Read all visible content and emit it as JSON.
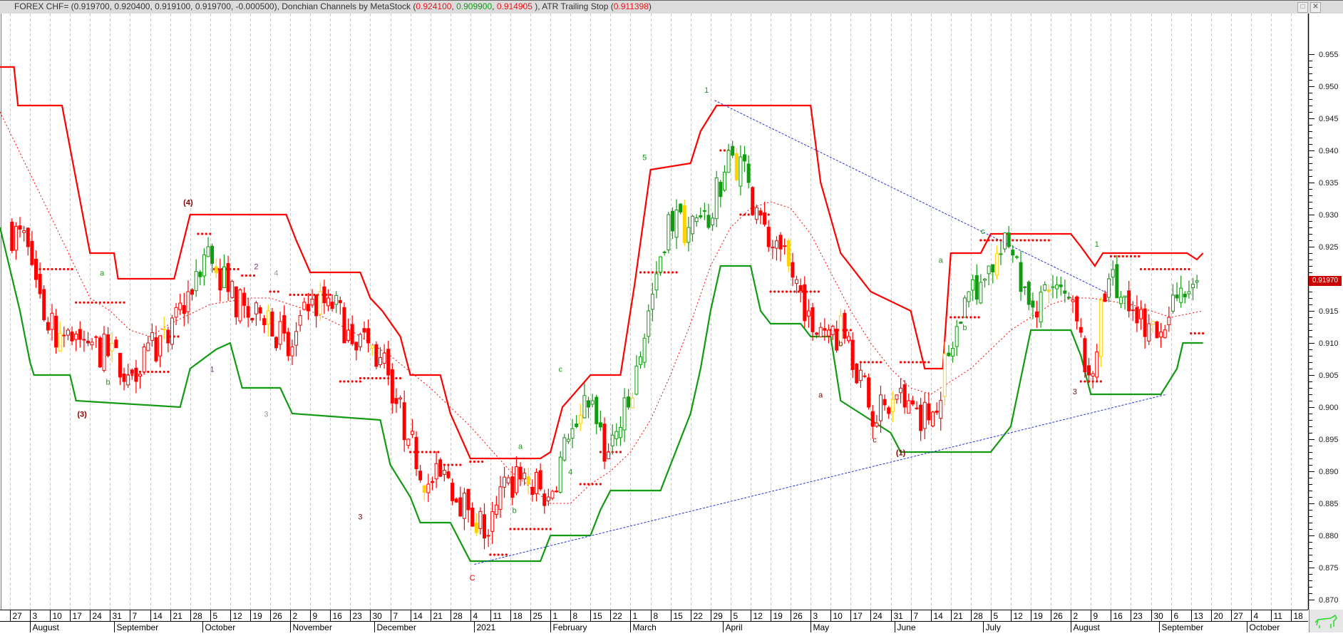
{
  "window": {
    "title_prefix": "FOREX CHF= (0.919700, 0.920400, 0.919100, 0.919700, -0.000500), Donchian Channels by MetaStock (",
    "donchian_upper": "0.924100",
    "donchian_lower": "0.909900",
    "donchian_mid": "0.914905",
    "atr_prefix": " ), ATR Trailing Stop (",
    "atr_value": "0.911398",
    "title_suffix": ")",
    "maximize_icon": "maximize-icon",
    "close_icon": "close-icon",
    "logo_icon": "bull-icon"
  },
  "colors": {
    "up": "#139a13",
    "down": "#ff0000",
    "neutral": "#ffd200",
    "upper": "#ff0000",
    "lower": "#139a13",
    "trend": "#2233dd"
  },
  "chart_data": {
    "type": "candlestick",
    "title": "FOREX CHF=",
    "x_unit": "weeks since 2020-07-27",
    "ylim": [
      0.868,
      0.96
    ],
    "y_ticks": [
      "0.870",
      "0.875",
      "0.880",
      "0.885",
      "0.890",
      "0.895",
      "0.900",
      "0.905",
      "0.910",
      "0.915",
      "0.920",
      "0.925",
      "0.930",
      "0.935",
      "0.940",
      "0.945",
      "0.950",
      "0.955"
    ],
    "last_price_label": "0.91970",
    "last_price": 0.9197,
    "week_labels": [
      "27",
      "3",
      "10",
      "17",
      "24",
      "31",
      "7",
      "14",
      "21",
      "28",
      "5",
      "12",
      "19",
      "26",
      "2",
      "9",
      "16",
      "23",
      "30",
      "7",
      "14",
      "21",
      "28",
      "4",
      "11",
      "18",
      "25",
      "1",
      "8",
      "15",
      "22",
      "1",
      "8",
      "15",
      "22",
      "29",
      "5",
      "12",
      "19",
      "26",
      "3",
      "10",
      "17",
      "24",
      "31",
      "7",
      "14",
      "21",
      "28",
      "5",
      "12",
      "19",
      "26",
      "2",
      "9",
      "16",
      "23",
      "30",
      "6",
      "13",
      "20",
      "27",
      "4",
      "11",
      "18"
    ],
    "month_labels": [
      {
        "label": "August",
        "week": 1.0
      },
      {
        "label": "September",
        "week": 5.2
      },
      {
        "label": "October",
        "week": 9.6
      },
      {
        "label": "November",
        "week": 14.0
      },
      {
        "label": "December",
        "week": 18.2
      },
      {
        "label": "2021",
        "week": 23.2
      },
      {
        "label": "February",
        "week": 27.0
      },
      {
        "label": "March",
        "week": 31.0
      },
      {
        "label": "April",
        "week": 35.6
      },
      {
        "label": "May",
        "week": 40.0
      },
      {
        "label": "June",
        "week": 44.2
      },
      {
        "label": "July",
        "week": 48.6
      },
      {
        "label": "August",
        "week": 53.0
      },
      {
        "label": "September",
        "week": 57.4
      },
      {
        "label": "October",
        "week": 61.8
      }
    ],
    "weekly_close": [
      0.928,
      0.925,
      0.912,
      0.912,
      0.91,
      0.908,
      0.905,
      0.91,
      0.91,
      0.918,
      0.925,
      0.918,
      0.914,
      0.915,
      0.908,
      0.915,
      0.917,
      0.912,
      0.91,
      0.905,
      0.895,
      0.888,
      0.889,
      0.884,
      0.88,
      0.889,
      0.888,
      0.886,
      0.895,
      0.9,
      0.893,
      0.9,
      0.915,
      0.93,
      0.928,
      0.928,
      0.94,
      0.935,
      0.925,
      0.922,
      0.915,
      0.912,
      0.911,
      0.9,
      0.899,
      0.901,
      0.898,
      0.908,
      0.918,
      0.922,
      0.925,
      0.916,
      0.918,
      0.917,
      0.905,
      0.92,
      0.915,
      0.913,
      0.914,
      0.918,
      0.9197
    ],
    "weekly_close_start_week": -1,
    "donchian_upper": [
      [
        -0.6,
        0.953
      ],
      [
        0.2,
        0.953
      ],
      [
        0.4,
        0.947
      ],
      [
        2.6,
        0.947
      ],
      [
        4,
        0.924
      ],
      [
        5.2,
        0.924
      ],
      [
        5.4,
        0.92
      ],
      [
        8.2,
        0.92
      ],
      [
        9,
        0.93
      ],
      [
        13.8,
        0.93
      ],
      [
        14.3,
        0.926
      ],
      [
        15,
        0.921
      ],
      [
        17.5,
        0.921
      ],
      [
        18,
        0.917
      ],
      [
        18.6,
        0.915
      ],
      [
        19.5,
        0.911
      ],
      [
        20,
        0.905
      ],
      [
        21.5,
        0.905
      ],
      [
        22,
        0.899
      ],
      [
        23,
        0.892
      ],
      [
        26.5,
        0.892
      ],
      [
        27,
        0.893
      ],
      [
        27.6,
        0.9
      ],
      [
        29,
        0.905
      ],
      [
        30.5,
        0.905
      ],
      [
        31.2,
        0.919
      ],
      [
        32,
        0.937
      ],
      [
        34,
        0.938
      ],
      [
        34.5,
        0.943
      ],
      [
        35.3,
        0.947
      ],
      [
        40,
        0.947
      ],
      [
        40.5,
        0.935
      ],
      [
        41.5,
        0.924
      ],
      [
        43,
        0.918
      ],
      [
        45,
        0.915
      ],
      [
        45.7,
        0.906
      ],
      [
        46.6,
        0.906
      ],
      [
        47,
        0.924
      ],
      [
        48.5,
        0.924
      ],
      [
        49,
        0.927
      ],
      [
        53,
        0.927
      ],
      [
        53.5,
        0.925
      ],
      [
        54.2,
        0.922
      ],
      [
        54.6,
        0.924
      ],
      [
        58.8,
        0.924
      ],
      [
        59.3,
        0.923
      ],
      [
        59.6,
        0.924
      ]
    ],
    "donchian_lower": [
      [
        -0.5,
        0.928
      ],
      [
        0.5,
        0.915
      ],
      [
        1,
        0.907
      ],
      [
        1.2,
        0.905
      ],
      [
        3,
        0.905
      ],
      [
        3.3,
        0.901
      ],
      [
        8.5,
        0.9
      ],
      [
        9,
        0.906
      ],
      [
        10.3,
        0.909
      ],
      [
        11,
        0.91
      ],
      [
        11.6,
        0.903
      ],
      [
        13.5,
        0.903
      ],
      [
        14.1,
        0.899
      ],
      [
        18.5,
        0.898
      ],
      [
        19,
        0.891
      ],
      [
        20,
        0.886
      ],
      [
        20.5,
        0.882
      ],
      [
        22,
        0.882
      ],
      [
        23,
        0.876
      ],
      [
        26.5,
        0.876
      ],
      [
        27,
        0.88
      ],
      [
        29,
        0.88
      ],
      [
        29.5,
        0.884
      ],
      [
        30,
        0.887
      ],
      [
        32.5,
        0.887
      ],
      [
        33,
        0.891
      ],
      [
        34,
        0.899
      ],
      [
        34.5,
        0.906
      ],
      [
        35,
        0.915
      ],
      [
        35.5,
        0.922
      ],
      [
        37,
        0.922
      ],
      [
        37.5,
        0.915
      ],
      [
        38,
        0.913
      ],
      [
        39.5,
        0.913
      ],
      [
        40,
        0.911
      ],
      [
        41,
        0.911
      ],
      [
        41.5,
        0.901
      ],
      [
        42.5,
        0.899
      ],
      [
        44,
        0.896
      ],
      [
        44.5,
        0.893
      ],
      [
        49,
        0.893
      ],
      [
        50,
        0.897
      ],
      [
        51,
        0.912
      ],
      [
        53,
        0.912
      ],
      [
        53.5,
        0.908
      ],
      [
        54,
        0.902
      ],
      [
        57.5,
        0.902
      ],
      [
        58.3,
        0.906
      ],
      [
        58.6,
        0.91
      ],
      [
        59.6,
        0.91
      ]
    ],
    "donchian_mid_ma": [
      [
        -0.5,
        0.946
      ],
      [
        2,
        0.93
      ],
      [
        4,
        0.917
      ],
      [
        5,
        0.915
      ],
      [
        6,
        0.912
      ],
      [
        7,
        0.911
      ],
      [
        8,
        0.913
      ],
      [
        10,
        0.916
      ],
      [
        12,
        0.917
      ],
      [
        13,
        0.917
      ],
      [
        15,
        0.915
      ],
      [
        17,
        0.912
      ],
      [
        19,
        0.908
      ],
      [
        21,
        0.903
      ],
      [
        23,
        0.897
      ],
      [
        25,
        0.89
      ],
      [
        27,
        0.885
      ],
      [
        28,
        0.885
      ],
      [
        29,
        0.888
      ],
      [
        30,
        0.89
      ],
      [
        31,
        0.893
      ],
      [
        32,
        0.898
      ],
      [
        33,
        0.905
      ],
      [
        34,
        0.913
      ],
      [
        35,
        0.922
      ],
      [
        36,
        0.928
      ],
      [
        37,
        0.931
      ],
      [
        38,
        0.932
      ],
      [
        39,
        0.931
      ],
      [
        40,
        0.927
      ],
      [
        41,
        0.921
      ],
      [
        42,
        0.915
      ],
      [
        43,
        0.91
      ],
      [
        44,
        0.906
      ],
      [
        45,
        0.903
      ],
      [
        46,
        0.902
      ],
      [
        47,
        0.904
      ],
      [
        48,
        0.906
      ],
      [
        49,
        0.909
      ],
      [
        50,
        0.912
      ],
      [
        51,
        0.914
      ],
      [
        52,
        0.916
      ],
      [
        53,
        0.917
      ],
      [
        54,
        0.917
      ],
      [
        56,
        0.916
      ],
      [
        58,
        0.914
      ],
      [
        59.6,
        0.915
      ]
    ],
    "atr_stop_segments": [
      [
        1.5,
        3.2,
        0.9215
      ],
      [
        3.3,
        5.8,
        0.9163
      ],
      [
        5.9,
        6.2,
        0.905
      ],
      [
        6.3,
        7.9,
        0.9055
      ],
      [
        8.0,
        8.5,
        0.911
      ],
      [
        9.4,
        10,
        0.927
      ],
      [
        10.2,
        11.5,
        0.9215
      ],
      [
        11.6,
        12.3,
        0.9205
      ],
      [
        13,
        13.5,
        0.918
      ],
      [
        14.0,
        16,
        0.9175
      ],
      [
        16.5,
        17.5,
        0.904
      ],
      [
        17.5,
        19.5,
        0.9045
      ],
      [
        20,
        21.5,
        0.893
      ],
      [
        21.5,
        22.5,
        0.891
      ],
      [
        23.0,
        23.7,
        0.8915
      ],
      [
        24,
        24.8,
        0.877
      ],
      [
        25,
        27,
        0.881
      ],
      [
        28.5,
        29.5,
        0.888
      ],
      [
        29.5,
        30.5,
        0.893
      ],
      [
        31.5,
        33.3,
        0.921
      ],
      [
        35.5,
        36,
        0.94
      ],
      [
        36.5,
        38,
        0.93
      ],
      [
        38,
        40.5,
        0.918
      ],
      [
        41,
        42,
        0.912
      ],
      [
        42.5,
        43.5,
        0.907
      ],
      [
        44.5,
        46,
        0.907
      ],
      [
        47,
        48.5,
        0.914
      ],
      [
        48.5,
        52,
        0.926
      ],
      [
        53.5,
        54.5,
        0.904
      ],
      [
        55,
        56.5,
        0.9235
      ],
      [
        56.5,
        59,
        0.9215
      ],
      [
        59,
        59.6,
        0.9115
      ]
    ],
    "trend_lines": [
      [
        [
          23.2,
          0.8755
        ],
        [
          57.8,
          0.902
        ]
      ],
      [
        [
          35.2,
          0.9478
        ],
        [
          55,
          0.9175
        ]
      ]
    ],
    "wave_labels": [
      {
        "text": "(3)",
        "week": 3.6,
        "price": 0.8985,
        "color": "#8b0000"
      },
      {
        "text": "a",
        "week": 4.6,
        "price": 0.9205,
        "color": "#139a13"
      },
      {
        "text": "b",
        "week": 4.9,
        "price": 0.9035,
        "color": "#139a13"
      },
      {
        "text": "(4)",
        "week": 8.9,
        "price": 0.9315,
        "color": "#8b0000"
      },
      {
        "text": "1",
        "week": 10.1,
        "price": 0.9055,
        "color": "#7a2a7a"
      },
      {
        "text": "2",
        "week": 12.3,
        "price": 0.9215,
        "color": "#7a2a7a"
      },
      {
        "text": "3",
        "week": 12.8,
        "price": 0.8985,
        "color": "#999999"
      },
      {
        "text": "4",
        "week": 13.3,
        "price": 0.9205,
        "color": "#999999"
      },
      {
        "text": "3",
        "week": 17.5,
        "price": 0.8825,
        "color": "#8b0000"
      },
      {
        "text": "C",
        "week": 23.1,
        "price": 0.873,
        "color": "#ff0000"
      },
      {
        "text": "a",
        "week": 25.5,
        "price": 0.8935,
        "color": "#139a13"
      },
      {
        "text": "b",
        "week": 25.2,
        "price": 0.8835,
        "color": "#139a13"
      },
      {
        "text": "c",
        "week": 27.5,
        "price": 0.9055,
        "color": "#139a13"
      },
      {
        "text": "4",
        "week": 28.0,
        "price": 0.8895,
        "color": "#139a13"
      },
      {
        "text": "5",
        "week": 31.7,
        "price": 0.9385,
        "color": "#139a13"
      },
      {
        "text": "1",
        "week": 34.8,
        "price": 0.949,
        "color": "#139a13"
      },
      {
        "text": "a",
        "week": 40.5,
        "price": 0.9015,
        "color": "#8b0000"
      },
      {
        "text": "b",
        "week": 41.5,
        "price": 0.9095,
        "color": "#8b0000"
      },
      {
        "text": "c",
        "week": 43.2,
        "price": 0.8945,
        "color": "#8b0000"
      },
      {
        "text": "(1)",
        "week": 44.5,
        "price": 0.8925,
        "color": "#8b0000"
      },
      {
        "text": "a",
        "week": 46.5,
        "price": 0.9225,
        "color": "#139a13"
      },
      {
        "text": "b",
        "week": 47.7,
        "price": 0.912,
        "color": "#139a13"
      },
      {
        "text": "c",
        "week": 48.6,
        "price": 0.927,
        "color": "#139a13"
      },
      {
        "text": "3",
        "week": 53.2,
        "price": 0.902,
        "color": "#8b0000"
      },
      {
        "text": "1",
        "week": 54.3,
        "price": 0.925,
        "color": "#139a13"
      }
    ]
  }
}
